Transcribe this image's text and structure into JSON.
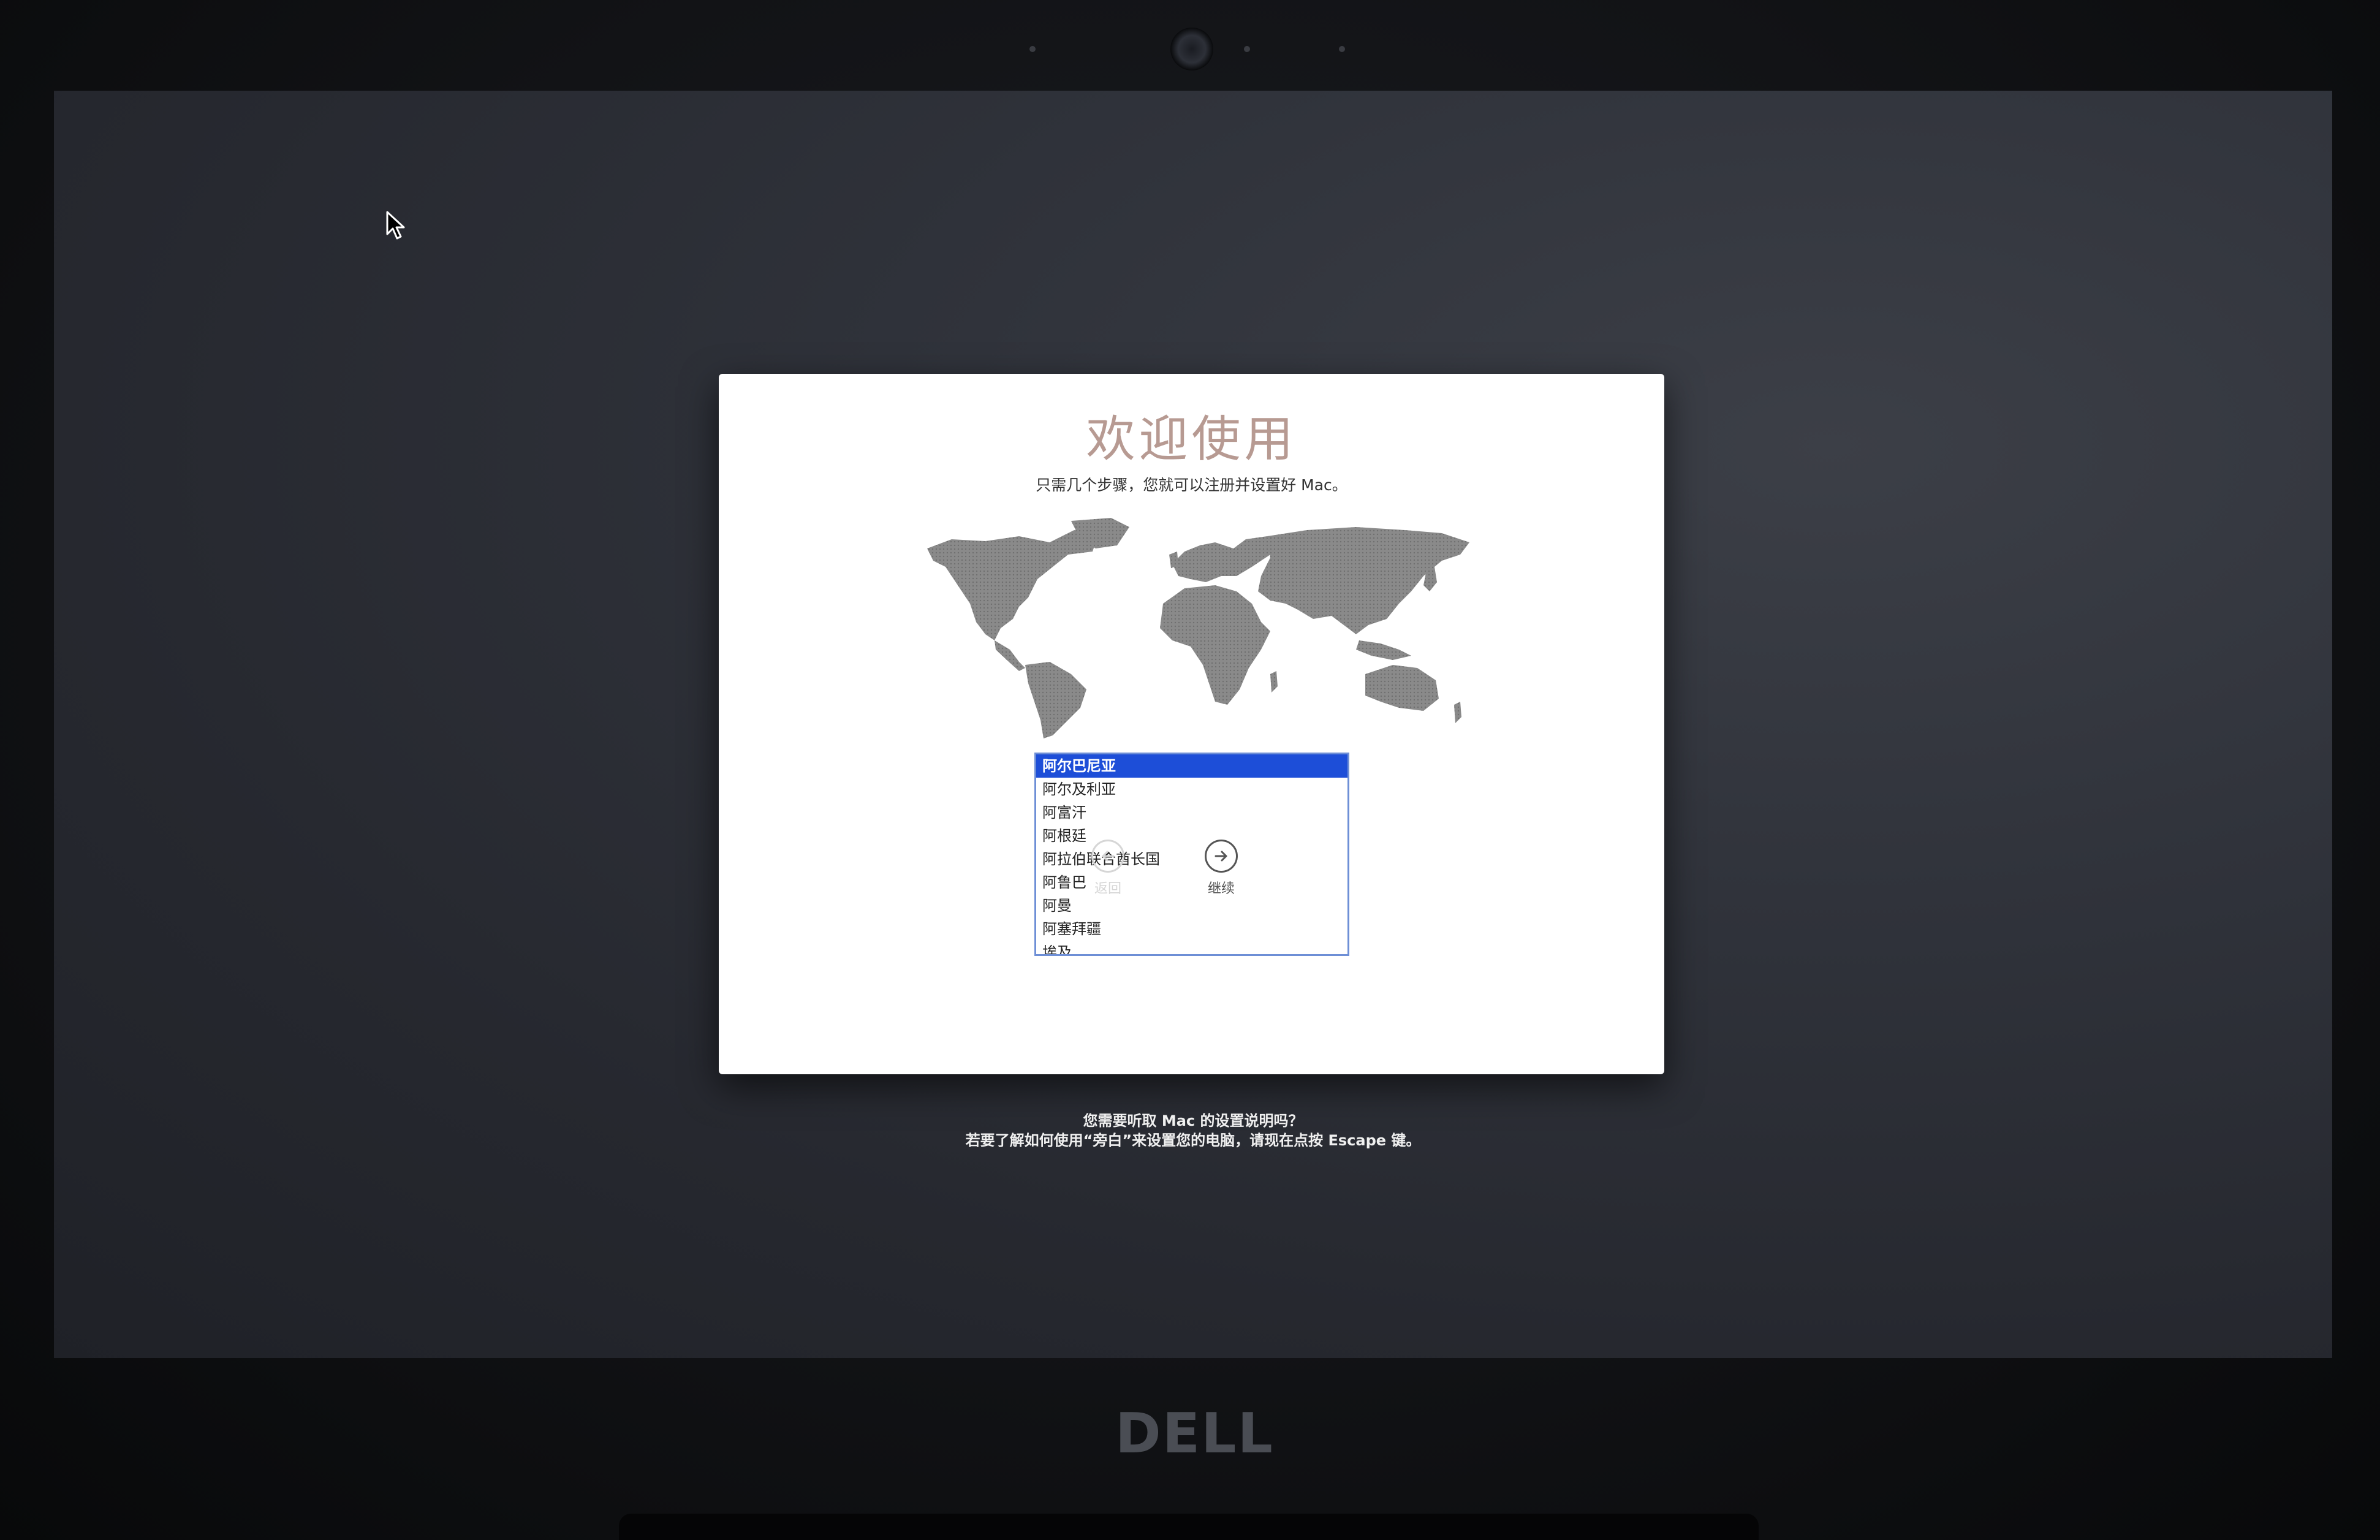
{
  "window": {
    "title": "欢迎使用",
    "subtitle": "只需几个步骤，您就可以注册并设置好 Mac。"
  },
  "country_list": {
    "items": [
      "阿尔巴尼亚",
      "阿尔及利亚",
      "阿富汗",
      "阿根廷",
      "阿拉伯联合酋长国",
      "阿鲁巴",
      "阿曼",
      "阿塞拜疆",
      "埃及"
    ],
    "selected": "阿尔巴尼亚",
    "selection_color": "#1d4ed8"
  },
  "nav": {
    "back_label": "返回",
    "continue_label": "继续"
  },
  "help": {
    "line1": "您需要听取 Mac 的设置说明吗？",
    "line2": "若要了解如何使用“旁白”来设置您的电脑，请现在点按 Escape 键。"
  },
  "bezel": {
    "logo": "DELL"
  },
  "icons": {
    "back": "arrow-left-circle-icon",
    "continue": "arrow-right-circle-icon",
    "cursor": "mouse-pointer-icon",
    "camera": "webcam-icon"
  }
}
